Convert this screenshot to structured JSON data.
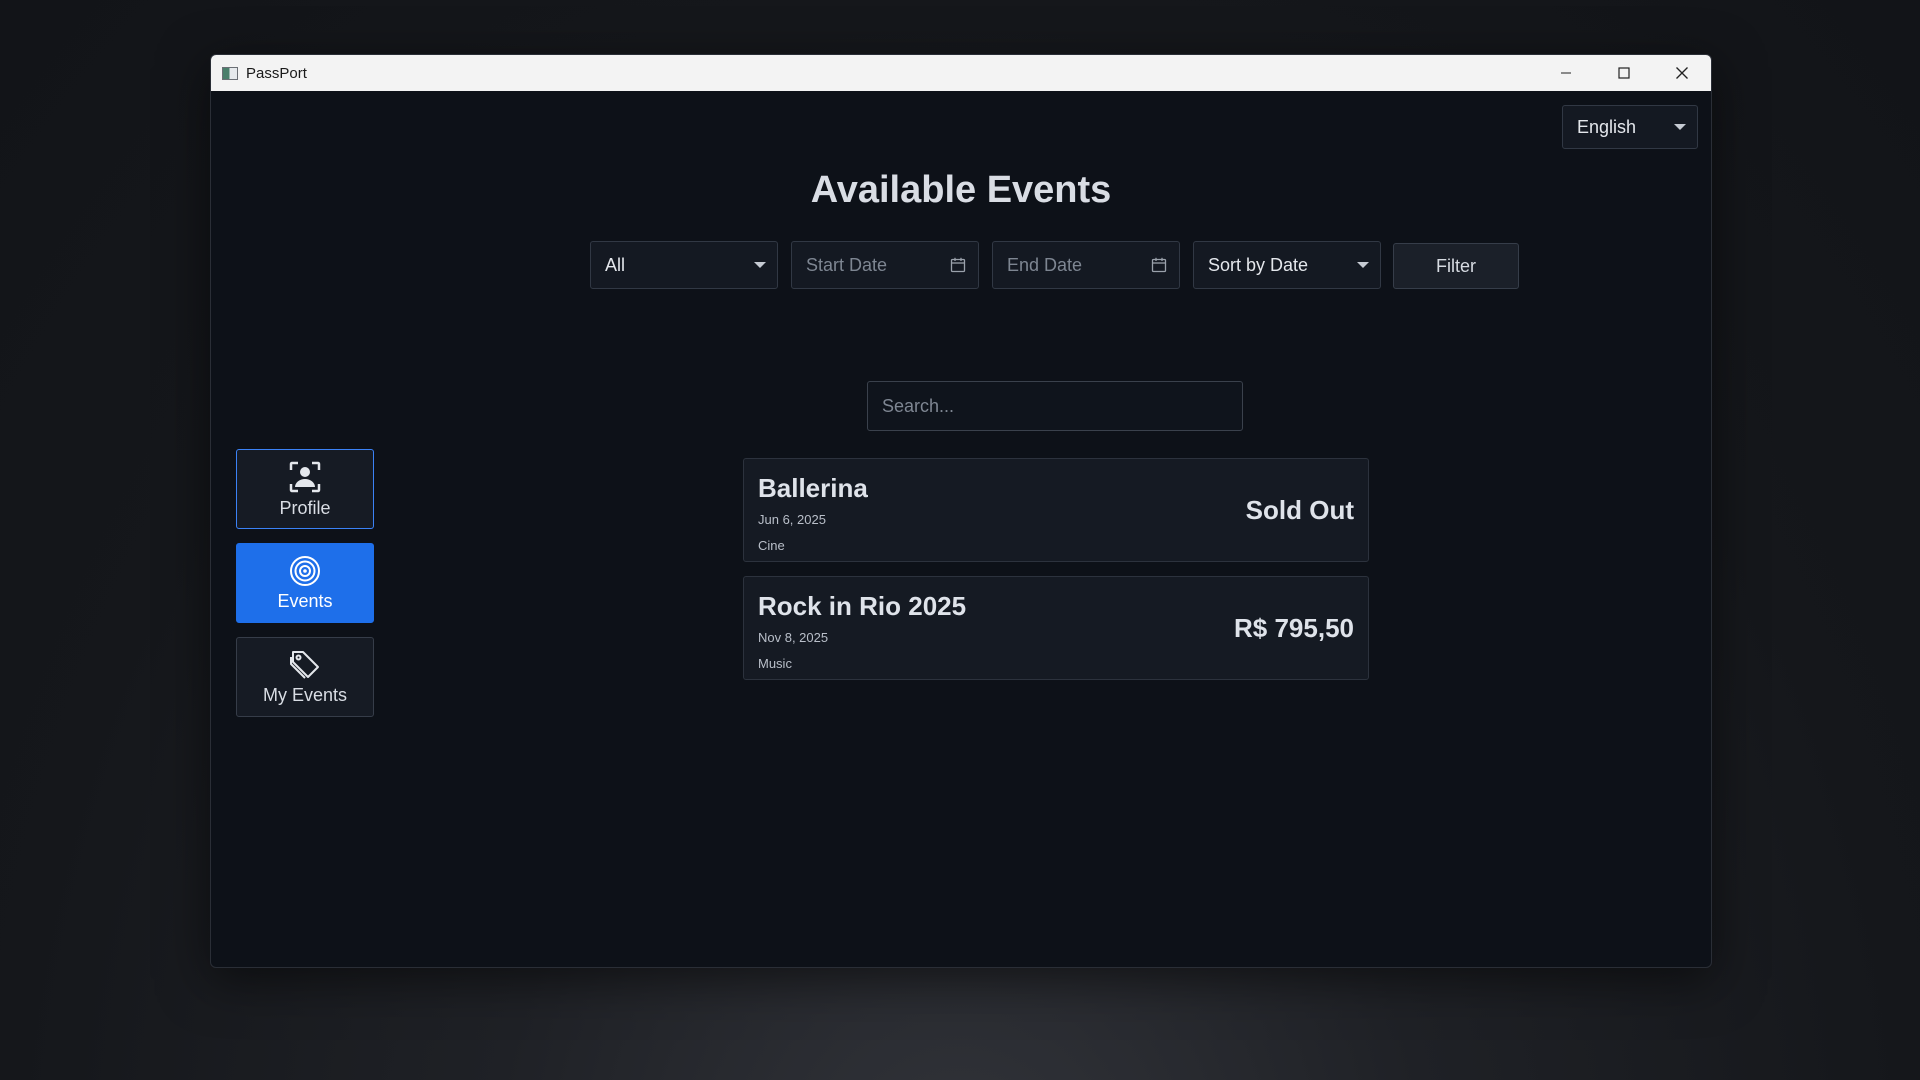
{
  "window": {
    "title": "PassPort"
  },
  "language_select": {
    "value": "English"
  },
  "page": {
    "title": "Available Events"
  },
  "filters": {
    "category": "All",
    "start_date_placeholder": "Start Date",
    "end_date_placeholder": "End Date",
    "sort": "Sort by Date",
    "filter_label": "Filter"
  },
  "search": {
    "placeholder": "Search..."
  },
  "sidebar": {
    "items": [
      {
        "label": "Profile",
        "icon": "profile-icon"
      },
      {
        "label": "Events",
        "icon": "events-icon"
      },
      {
        "label": "My Events",
        "icon": "tags-icon"
      }
    ]
  },
  "events": [
    {
      "name": "Ballerina",
      "date": "Jun 6, 2025",
      "category": "Cine",
      "price": "Sold Out"
    },
    {
      "name": "Rock in Rio 2025",
      "date": "Nov 8, 2025",
      "category": "Music",
      "price": "R$ 795,50"
    }
  ],
  "colors": {
    "accent": "#1e6fea",
    "background": "#0d1118",
    "card": "#151a23"
  }
}
